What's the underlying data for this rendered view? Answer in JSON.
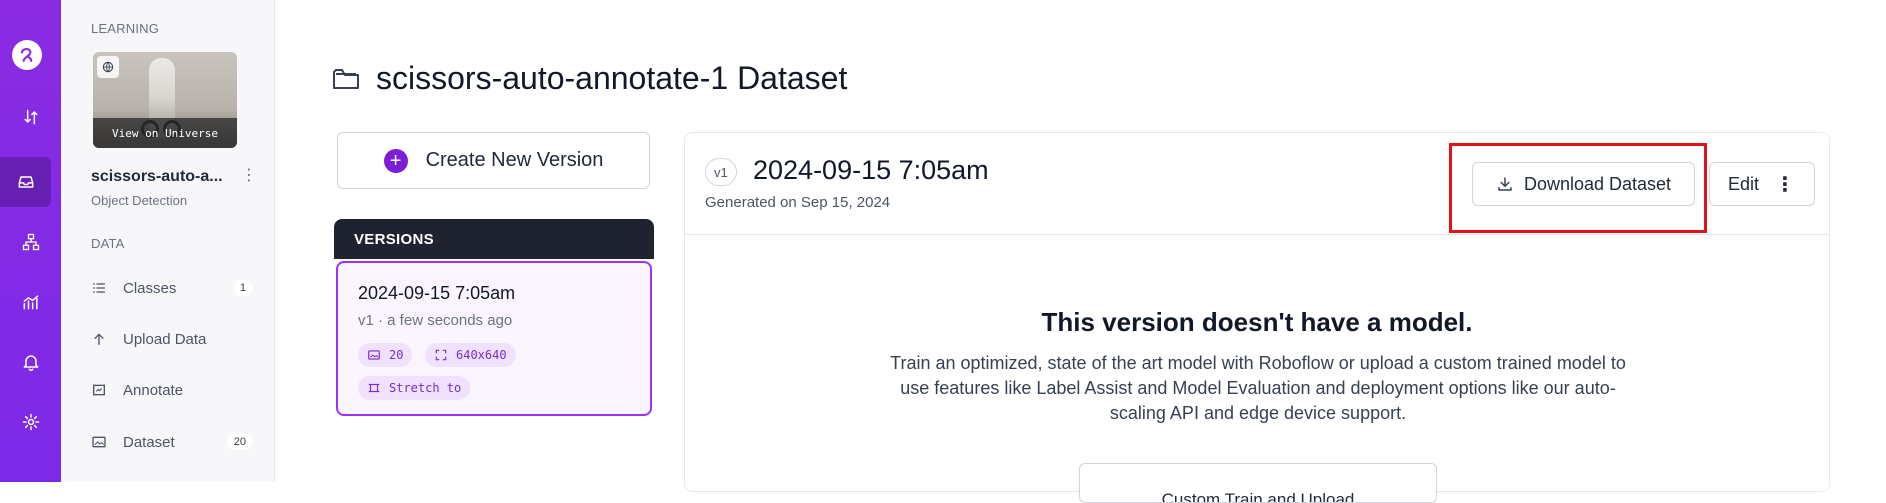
{
  "sidebar": {
    "learning_label": "LEARNING",
    "thumbnail_overlay": "View on Universe",
    "project_name": "scissors-auto-a...",
    "project_menu": "⋮",
    "project_type": "Object Detection",
    "data_label": "DATA",
    "items": [
      {
        "label": "Classes",
        "icon": "list-icon",
        "count": "1"
      },
      {
        "label": "Upload Data",
        "icon": "upload-icon",
        "count": ""
      },
      {
        "label": "Annotate",
        "icon": "annotate-icon",
        "count": ""
      },
      {
        "label": "Dataset",
        "icon": "image-icon",
        "count": "20"
      }
    ]
  },
  "rail": {
    "items": [
      "logo-icon",
      "sort-icon",
      "inbox-icon",
      "hierarchy-icon",
      "analytics-icon",
      "bell-icon",
      "gear-icon"
    ],
    "active": "inbox-icon"
  },
  "page": {
    "title": "scissors-auto-annotate-1 Dataset"
  },
  "create_version": {
    "label": "Create New Version"
  },
  "versions": {
    "header": "VERSIONS",
    "items": [
      {
        "title": "2024-09-15 7:05am",
        "subtitle": "v1 · a few seconds ago",
        "chips": [
          {
            "icon": "image-icon",
            "label": "20"
          },
          {
            "icon": "resize-icon",
            "label": "640x640"
          },
          {
            "icon": "crop-icon",
            "label": "Stretch to"
          }
        ]
      }
    ]
  },
  "version_panel": {
    "badge": "v1",
    "title": "2024-09-15 7:05am",
    "generated": "Generated on Sep 15, 2024",
    "download_label": "Download Dataset",
    "edit_label": "Edit",
    "edit_menu": "⋮",
    "no_model_title": "This version doesn't have a model.",
    "no_model_desc": "Train an optimized, state of the art model with Roboflow or upload a custom trained model to use features like Label Assist and Model Evaluation and deployment options like our auto-scaling API and edge device support.",
    "custom_button": "Custom Train and Upload"
  },
  "colors": {
    "rail": "#8a2be2",
    "accent": "#7a1fd6",
    "highlight": "#e0131a"
  }
}
